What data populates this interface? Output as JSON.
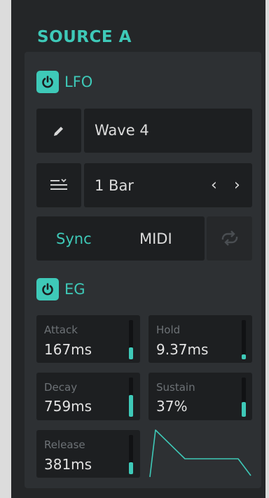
{
  "section": {
    "title": "SOURCE A"
  },
  "lfo": {
    "label": "LFO",
    "power_on": true,
    "wave": {
      "value": "Wave 4"
    },
    "rate": {
      "value": "1 Bar",
      "prev": "‹",
      "next": "›"
    },
    "sync": {
      "sync_label": "Sync",
      "midi_label": "MIDI"
    }
  },
  "eg": {
    "label": "EG",
    "power_on": true,
    "attack": {
      "name": "Attack",
      "value": "167ms",
      "level": 0.3
    },
    "hold": {
      "name": "Hold",
      "value": "9.37ms",
      "level": 0.12
    },
    "decay": {
      "name": "Decay",
      "value": "759ms",
      "level": 0.55
    },
    "sustain": {
      "name": "Sustain",
      "value": "37%",
      "level": 0.37
    },
    "release": {
      "name": "Release",
      "value": "381ms",
      "level": 0.3
    }
  },
  "colors": {
    "accent": "#3ec9b8",
    "panel": "#242628",
    "inner": "#2d3033",
    "box": "#1d1f21"
  },
  "icons": [
    "power-icon",
    "pencil-icon",
    "rate-list-icon",
    "loop-icon",
    "envelope-shape"
  ]
}
